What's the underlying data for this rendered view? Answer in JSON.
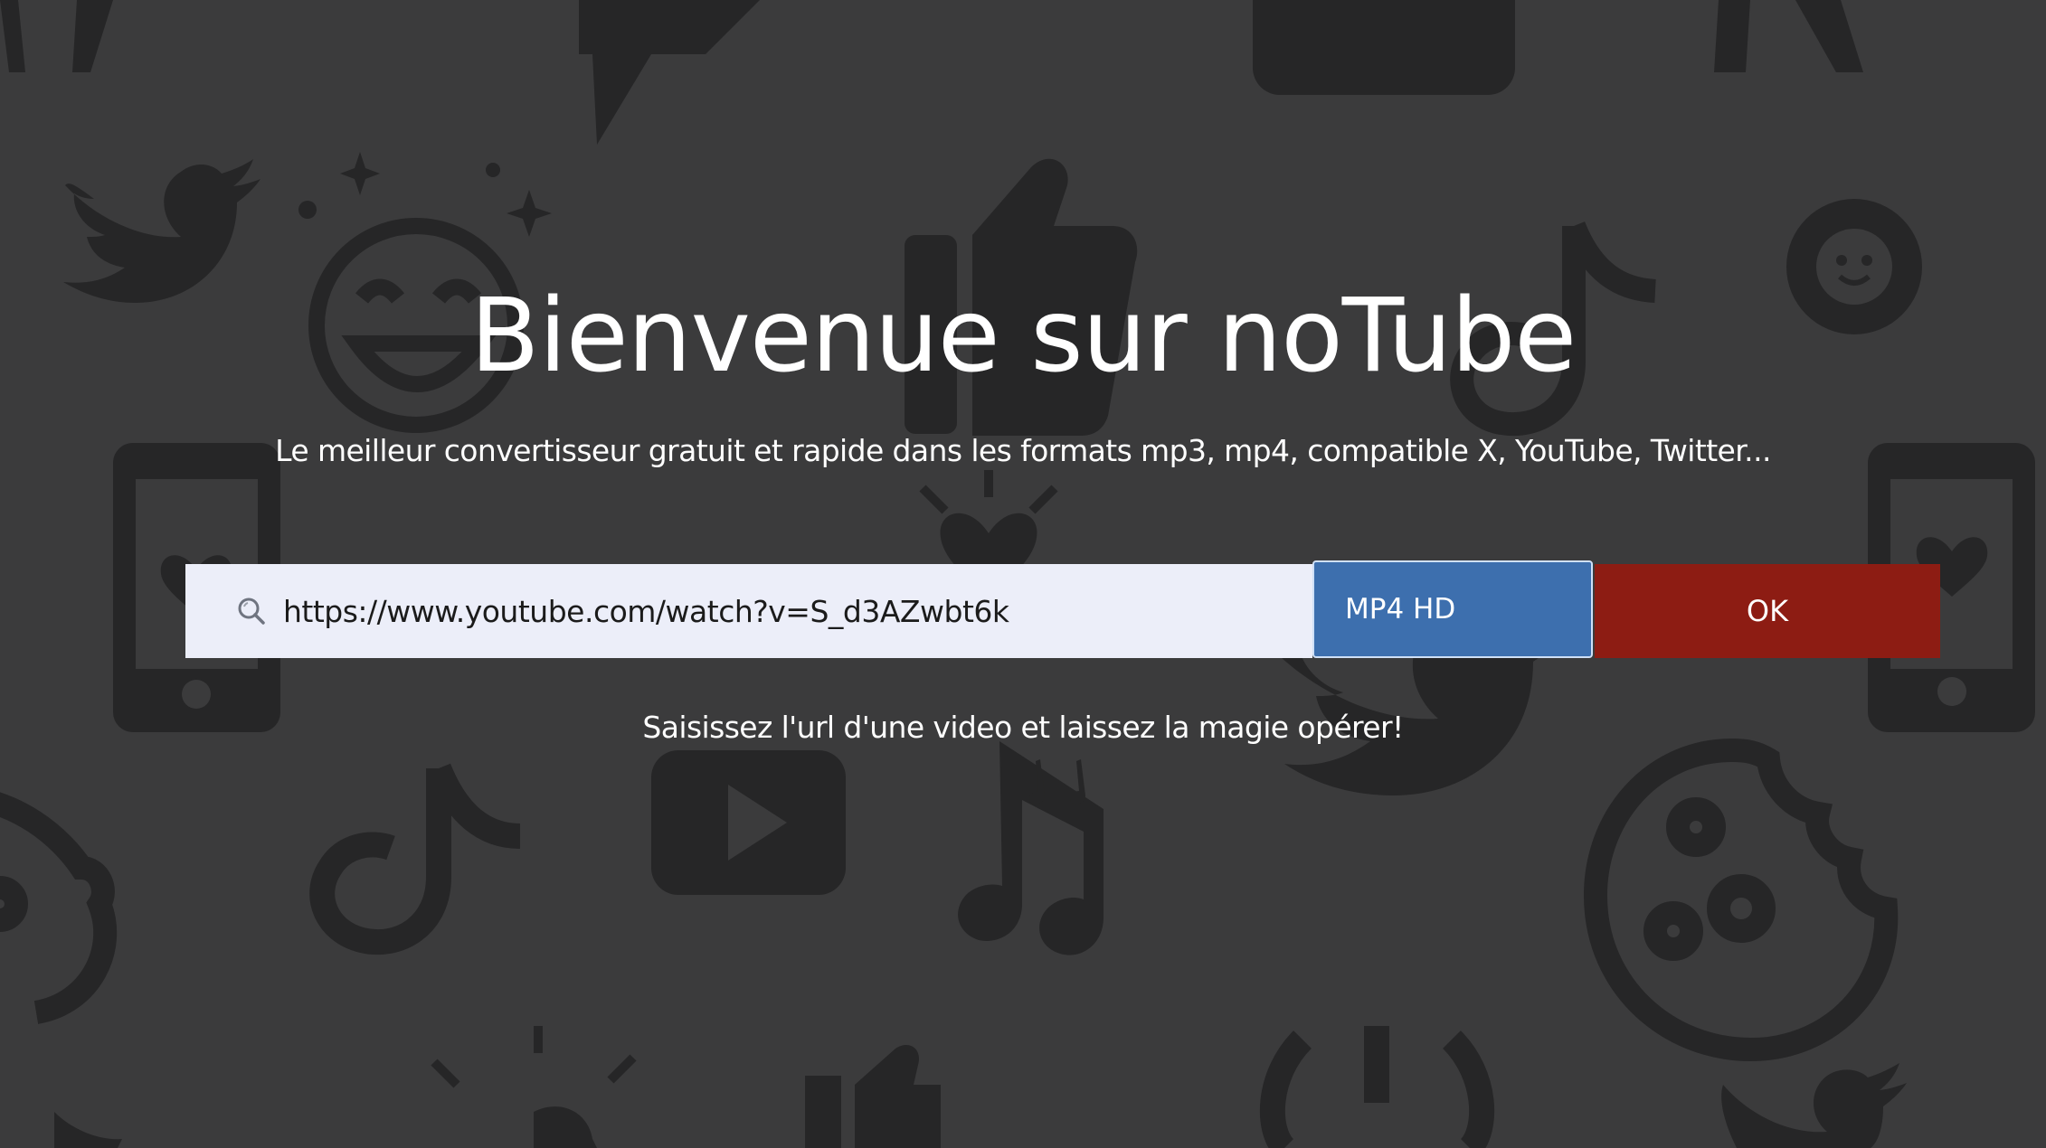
{
  "hero": {
    "title": "Bienvenue sur noTube",
    "subtitle": "Le meilleur convertisseur gratuit et rapide dans les formats mp3, mp4, compatible X, YouTube, Twitter..."
  },
  "search": {
    "url_value": "https://www.youtube.com/watch?v=S_d3AZwbt6k",
    "icon": "search-icon",
    "format_selected": "MP4 HD",
    "submit_label": "OK",
    "hint": "Saisissez l'url d'une video et laissez la magie opérer!"
  },
  "background_icons": [
    "twitter-icon",
    "smiley-icon",
    "thumbs-up-icon",
    "tiktok-icon",
    "youtube-icon",
    "music-note-icon",
    "cookie-icon",
    "phone-heart-icon",
    "badge-icon",
    "heart-burst-icon",
    "chat-bubble-icon"
  ],
  "colors": {
    "background": "#3b3b3c",
    "icon_pattern": "#262627",
    "input_background": "#eceef9",
    "format_button": "#3d6fae",
    "ok_button": "#8d1c13",
    "text": "#ffffff"
  }
}
